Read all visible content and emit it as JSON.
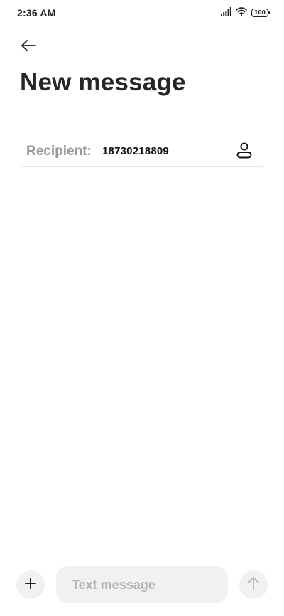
{
  "status_bar": {
    "time": "2:36 AM",
    "battery": "100",
    "icons": [
      "signal-icon",
      "wifi-icon",
      "battery-icon"
    ]
  },
  "header": {
    "back_icon": "arrow-left-icon",
    "title": "New message"
  },
  "recipient": {
    "label": "Recipient:",
    "value": "18730218809",
    "contact_icon": "person-icon"
  },
  "compose": {
    "add_icon": "plus-icon",
    "placeholder": "Text message",
    "value": "",
    "send_icon": "arrow-up-icon"
  },
  "colors": {
    "background": "#ffffff",
    "title": "#262626",
    "label_gray": "#9a9a9a",
    "input_bg": "#f1f1f1",
    "placeholder": "#b3b3b3",
    "send_disabled": "#bdbdbd"
  }
}
